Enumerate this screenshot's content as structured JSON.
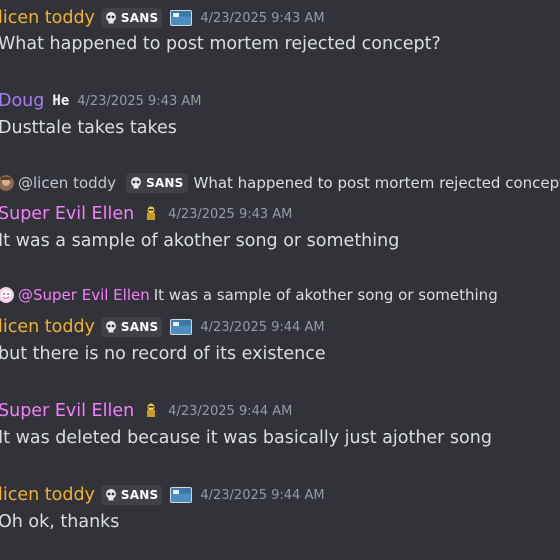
{
  "colors": {
    "background": "#313338",
    "licen": "#f0b232",
    "doug": "#a77bf3",
    "ellen": "#f47fff",
    "text": "#dbdee1",
    "muted": "#949ba4"
  },
  "messages": [
    {
      "author": "licen toddy",
      "tag": "SANS",
      "timestamp": "4/23/2025 9:43 AM",
      "content": "What happened to post mortem rejected concept?"
    },
    {
      "author": "Doug",
      "server_tag": "He",
      "timestamp": "4/23/2025 9:43 AM",
      "content": "Dusttale takes takes"
    },
    {
      "reply": {
        "mention": "@licen toddy",
        "tag": "SANS",
        "text": "What happened to post mortem rejected concept?"
      },
      "author": "Super Evil Ellen",
      "timestamp": "4/23/2025 9:43 AM",
      "content": "It was a sample of akother song or something"
    },
    {
      "reply": {
        "mention": "@Super Evil Ellen",
        "text": "It was a sample of akother song or something"
      },
      "author": "licen toddy",
      "tag": "SANS",
      "timestamp": "4/23/2025 9:44 AM",
      "content": "but there is no record of its existence"
    },
    {
      "author": "Super Evil Ellen",
      "timestamp": "4/23/2025 9:44 AM",
      "content": "It was deleted because it was basically just ajother song"
    },
    {
      "author": "licen toddy",
      "tag": "SANS",
      "timestamp": "4/23/2025 9:44 AM",
      "content": "Oh ok, thanks"
    }
  ]
}
